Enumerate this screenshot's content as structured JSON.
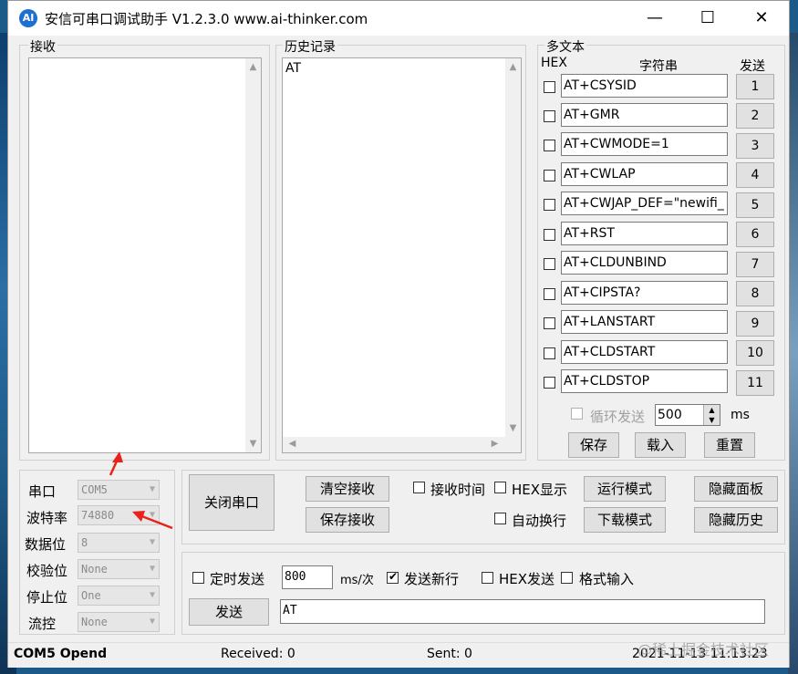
{
  "window": {
    "title": "安信可串口调试助手 V1.2.3.0    www.ai-thinker.com",
    "icon_text": "AI",
    "minimize": "—",
    "maximize": "☐",
    "close": "✕"
  },
  "receive": {
    "label": "接收"
  },
  "history": {
    "label": "历史记录",
    "items": [
      "AT"
    ]
  },
  "multi": {
    "label": "多文本",
    "hex_header": "HEX",
    "string_header": "字符串",
    "send_header": "发送",
    "commands": [
      {
        "cmd": "AT+CSYSID",
        "num": "1"
      },
      {
        "cmd": "AT+GMR",
        "num": "2"
      },
      {
        "cmd": "AT+CWMODE=1",
        "num": "3"
      },
      {
        "cmd": "AT+CWLAP",
        "num": "4"
      },
      {
        "cmd": "AT+CWJAP_DEF=\"newifi_",
        "num": "5"
      },
      {
        "cmd": "AT+RST",
        "num": "6"
      },
      {
        "cmd": "AT+CLDUNBIND",
        "num": "7"
      },
      {
        "cmd": "AT+CIPSTA?",
        "num": "8"
      },
      {
        "cmd": "AT+LANSTART",
        "num": "9"
      },
      {
        "cmd": "AT+CLDSTART",
        "num": "10"
      },
      {
        "cmd": "AT+CLDSTOP",
        "num": "11"
      }
    ],
    "loop_label": "循环发送",
    "loop_value": "500",
    "ms_label": "ms",
    "save": "保存",
    "load": "载入",
    "reset": "重置"
  },
  "serial": {
    "port_label": "串口",
    "port_value": "COM5",
    "baud_label": "波特率",
    "baud_value": "74880",
    "data_label": "数据位",
    "data_value": "8",
    "parity_label": "校验位",
    "parity_value": "None",
    "stop_label": "停止位",
    "stop_value": "One",
    "flow_label": "流控",
    "flow_value": "None"
  },
  "controls": {
    "close_port": "关闭串口",
    "clear_recv": "清空接收",
    "save_recv": "保存接收",
    "recv_time": "接收时间",
    "hex_display": "HEX显示",
    "auto_newline": "自动换行",
    "run_mode": "运行模式",
    "download_mode": "下载模式",
    "hide_panel": "隐藏面板",
    "hide_history": "隐藏历史"
  },
  "send": {
    "timed_send": "定时发送",
    "interval": "800",
    "interval_unit": "ms/次",
    "send_newline": "发送新行",
    "hex_send": "HEX发送",
    "format_input": "格式输入",
    "send_button": "发送",
    "input_value": "AT"
  },
  "status": {
    "port": "COM5 Opend",
    "received": "Received: 0",
    "sent": "Sent: 0",
    "datetime": "2021-11-13 11:13:23",
    "watermark": "@稀土掘金技术社区"
  }
}
